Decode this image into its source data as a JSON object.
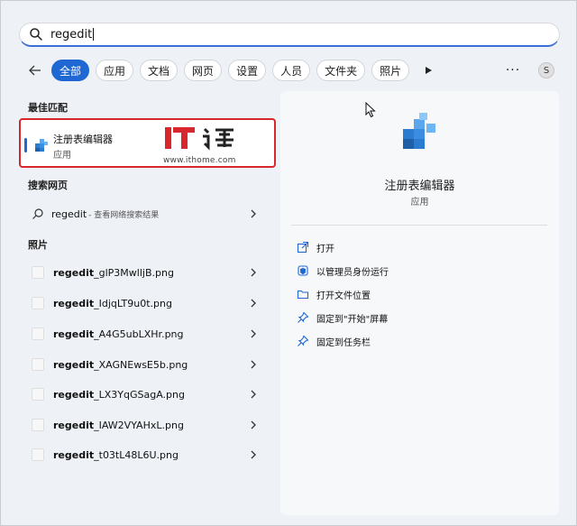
{
  "search": {
    "query": "regedit"
  },
  "filters": {
    "items": [
      "全部",
      "应用",
      "文档",
      "网页",
      "设置",
      "人员",
      "文件夹",
      "照片"
    ],
    "avatar_letter": "S",
    "more_label": "···"
  },
  "best_match": {
    "section_title": "最佳匹配",
    "name": "注册表编辑器",
    "type": "应用",
    "watermark_url": "www.ithome.com"
  },
  "web": {
    "section_title": "搜索网页",
    "query": "regedit",
    "description": "- 查看网络搜索结果"
  },
  "photos": {
    "section_title": "照片",
    "items": [
      {
        "bold": "regedit",
        "rest": "_glP3MwlljB.png"
      },
      {
        "bold": "regedit",
        "rest": "_IdjqLT9u0t.png"
      },
      {
        "bold": "regedit",
        "rest": "_A4G5ubLXHr.png"
      },
      {
        "bold": "regedit",
        "rest": "_XAGNEwsE5b.png"
      },
      {
        "bold": "regedit",
        "rest": "_LX3YqGSagA.png"
      },
      {
        "bold": "regedit",
        "rest": "_IAW2VYAHxL.png"
      },
      {
        "bold": "regedit",
        "rest": "_t03tL48L6U.png"
      }
    ]
  },
  "detail": {
    "title": "注册表编辑器",
    "subtitle": "应用",
    "actions": [
      "打开",
      "以管理员身份运行",
      "打开文件位置",
      "固定到\"开始\"屏幕",
      "固定到任务栏"
    ]
  },
  "colors": {
    "accent": "#1f67d2",
    "highlight_border": "#d7262c"
  }
}
